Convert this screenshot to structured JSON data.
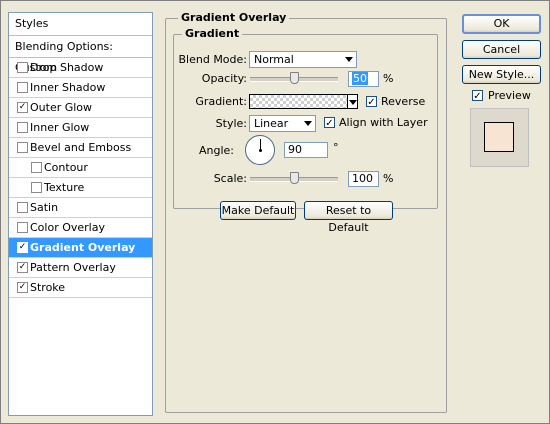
{
  "sidebar": {
    "header": "Styles",
    "blending_options": "Blending Options: Custom",
    "items": [
      {
        "label": "Drop Shadow",
        "checked": false,
        "check": "",
        "level": 0,
        "selected": false
      },
      {
        "label": "Inner Shadow",
        "checked": false,
        "check": "",
        "level": 0,
        "selected": false
      },
      {
        "label": "Outer Glow",
        "checked": true,
        "check": "✓",
        "level": 0,
        "selected": false
      },
      {
        "label": "Inner Glow",
        "checked": false,
        "check": "",
        "level": 0,
        "selected": false
      },
      {
        "label": "Bevel and Emboss",
        "checked": false,
        "check": "",
        "level": 0,
        "selected": false
      },
      {
        "label": "Contour",
        "checked": false,
        "check": "",
        "level": 1,
        "selected": false
      },
      {
        "label": "Texture",
        "checked": false,
        "check": "",
        "level": 1,
        "selected": false
      },
      {
        "label": "Satin",
        "checked": false,
        "check": "",
        "level": 0,
        "selected": false
      },
      {
        "label": "Color Overlay",
        "checked": false,
        "check": "",
        "level": 0,
        "selected": false
      },
      {
        "label": "Gradient Overlay",
        "checked": true,
        "check": "✓",
        "level": 0,
        "selected": true
      },
      {
        "label": "Pattern Overlay",
        "checked": true,
        "check": "✓",
        "level": 0,
        "selected": false
      },
      {
        "label": "Stroke",
        "checked": true,
        "check": "✓",
        "level": 0,
        "selected": false
      }
    ]
  },
  "panel": {
    "title": "Gradient Overlay",
    "group_title": "Gradient",
    "blend_mode_label": "Blend Mode:",
    "blend_mode_value": "Normal",
    "opacity_label": "Opacity:",
    "opacity_value": "50",
    "opacity_level": 0.5,
    "opacity_unit": "%",
    "gradient_label": "Gradient:",
    "reverse_label": "Reverse",
    "reverse_checked": true,
    "reverse_check": "✓",
    "style_label": "Style:",
    "style_value": "Linear",
    "align_label": "Align with Layer",
    "align_checked": true,
    "align_check": "✓",
    "angle_label": "Angle:",
    "angle_value": "90",
    "angle_unit": "°",
    "scale_label": "Scale:",
    "scale_value": "100",
    "scale_level": 0.5,
    "scale_unit": "%",
    "make_default": "Make Default",
    "reset_default": "Reset to Default"
  },
  "buttons": {
    "ok": "OK",
    "cancel": "Cancel",
    "new_style": "New Style...",
    "preview_label": "Preview",
    "preview_checked": true,
    "preview_check": "✓"
  },
  "colors": {
    "selection": "#3399ff",
    "preview_fill": "#f8e4d2"
  }
}
